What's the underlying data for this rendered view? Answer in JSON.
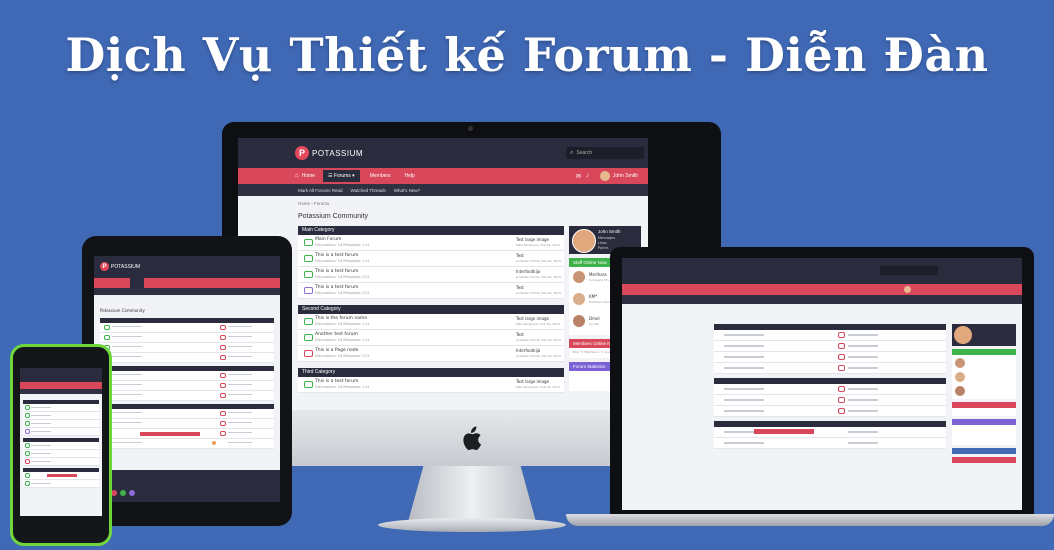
{
  "banner": {
    "title": "Dịch Vụ Thiết kế Forum - Diễn Đàn"
  },
  "colors": {
    "background": "#3f68b5",
    "header": "#2a2c3d",
    "accent": "#d9475b",
    "green": "#3db24a",
    "purple": "#8e6bd8"
  },
  "desktop": {
    "logo_letter": "P",
    "logo_text": "POTASSIUM",
    "search_placeholder": "Search",
    "nav": {
      "home": "Home",
      "forums": "Forums",
      "members": "Members",
      "help": "Help",
      "user": "John Smith"
    },
    "subnav": [
      "Mark All Forums Read",
      "Watched Threads",
      "What's New?"
    ],
    "breadcrumb": "Home › Forums",
    "page_title": "Potassium Community",
    "categories": [
      {
        "name": "Main Category",
        "forums": [
          {
            "title": "Main Forum",
            "stats": "Discussions: 18   Messages: 114",
            "latest": "Test large image",
            "latest_meta": "Mike Nickpiece, Feb 16, 2014",
            "icon": "green"
          },
          {
            "title": "This is a test forum",
            "stats": "Discussions: 16   Messages: 114",
            "latest": "Test",
            "latest_meta": "Jonathan Childs, Feb 16, 2014",
            "icon": "green"
          },
          {
            "title": "This is a test forum",
            "stats": "Discussions: 18   Messages: 213",
            "latest": "Interfootkija",
            "latest_meta": "Jonathan Childs, Feb 16, 2014",
            "icon": "green"
          },
          {
            "title": "This is a test forum",
            "stats": "Discussions: 18   Messages: 213",
            "latest": "Test",
            "latest_meta": "Jonathan Childs, Feb 16, 2014",
            "icon": "purple"
          }
        ]
      },
      {
        "name": "Second Category",
        "forums": [
          {
            "title": "This is the forum name",
            "stats": "Discussions: 18   Messages: 114",
            "latest": "Test large image",
            "latest_meta": "Mike Nickpiece, Feb 16, 2014",
            "icon": "green"
          },
          {
            "title": "Another test forum",
            "stats": "Discussions: 16   Messages: 114",
            "latest": "Test",
            "latest_meta": "Jonathan Childs, Feb 16, 2014",
            "icon": "green"
          },
          {
            "title": "This is a Page node",
            "stats": "Discussions: 16   Messages: 213",
            "latest": "Interfootkija",
            "latest_meta": "Jonathan Childs, Feb 16, 2014",
            "icon": "red"
          }
        ]
      },
      {
        "name": "Third Category",
        "forums": [
          {
            "title": "This is a test forum",
            "stats": "Discussions: 18   Messages: 114",
            "latest": "Test large image",
            "latest_meta": "Mike Nickpiece, Feb 16, 2014",
            "icon": "green"
          }
        ]
      }
    ],
    "sidebar": {
      "profile": {
        "name": "John Smith",
        "lines": [
          "Messages",
          "Likes",
          "Points"
        ]
      },
      "staff_title": "Staff Online Now",
      "staff": [
        {
          "name": "Merlhara",
          "role": "Company 5% "
        },
        {
          "name": "KM*",
          "role": "Northern Developer"
        },
        {
          "name": "Dmel",
          "role": "Scribal"
        }
      ],
      "members_title": "Members Online Now",
      "members_text": "Total: 5 (Members: 3, Guests: 2)",
      "stats_title": "Forum Statistics"
    }
  },
  "device_icon": "apple-logo-icon"
}
